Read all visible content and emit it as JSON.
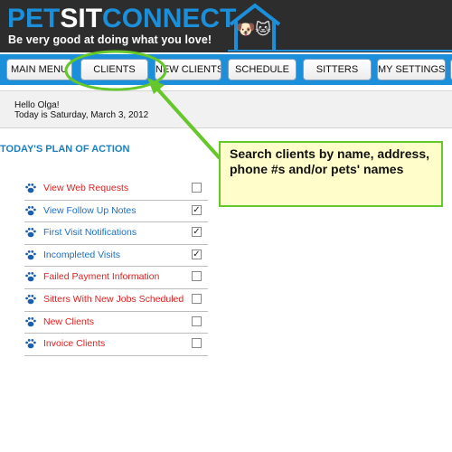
{
  "header": {
    "logo_part1": "PET",
    "logo_part2": "SIT",
    "logo_part3": "CONNECT",
    "tagline": "Be very good at doing what you love!",
    "mascot_icons": "🐶🐱",
    "colors": {
      "brand_blue": "#1b8fd9",
      "header_bg": "#2d2d2d"
    }
  },
  "nav": {
    "items": [
      {
        "label": "MAIN MENU"
      },
      {
        "label": "CLIENTS"
      },
      {
        "label": "NEW CLIENTS"
      },
      {
        "label": "SCHEDULE"
      },
      {
        "label": "SITTERS"
      },
      {
        "label": "MY SETTINGS"
      }
    ]
  },
  "greeting": {
    "hello": "Hello Olga!",
    "date": "Today is Saturday, March 3, 2012"
  },
  "plan": {
    "title": "TODAY'S PLAN OF ACTION",
    "items": [
      {
        "label": "View Web Requests",
        "color": "red",
        "checked": false
      },
      {
        "label": "View Follow Up Notes",
        "color": "blue",
        "checked": true
      },
      {
        "label": "First Visit Notifications",
        "color": "blue",
        "checked": true
      },
      {
        "label": "Incompleted Visits",
        "color": "blue",
        "checked": true
      },
      {
        "label": "Failed Payment Information",
        "color": "red",
        "checked": false
      },
      {
        "label": "Sitters With New Jobs Scheduled",
        "color": "red",
        "checked": false
      },
      {
        "label": "New Clients",
        "color": "red",
        "checked": false
      },
      {
        "label": "Invoice Clients",
        "color": "red",
        "checked": false
      }
    ]
  },
  "callout": {
    "text": "Search clients by name, address, phone #s and/or pets' names"
  }
}
